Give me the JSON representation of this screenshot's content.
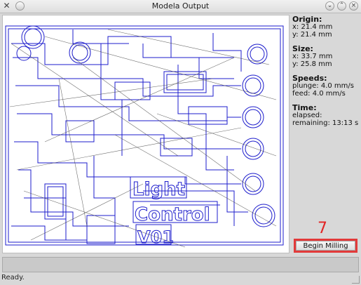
{
  "window": {
    "title": "Modela Output",
    "close_glyph": "✕"
  },
  "info": {
    "origin": {
      "heading": "Origin:",
      "x": "x: 21.4 mm",
      "y": "y: 21.4 mm"
    },
    "size": {
      "heading": "Size:",
      "x": "x: 33.7 mm",
      "y": "y: 25.8 mm"
    },
    "speeds": {
      "heading": "Speeds:",
      "plunge": "plunge: 4.0 mm/s",
      "feed": "feed: 4.0 mm/s"
    },
    "time": {
      "heading": "Time:",
      "elapsed": "elapsed:",
      "remaining": "remaining: 13:13 s"
    }
  },
  "annotation": {
    "step": "7",
    "color": "#e22525"
  },
  "actions": {
    "begin_label": "Begin Milling"
  },
  "status": {
    "text": "Ready."
  },
  "colors": {
    "toolpath": "#1d1dcc",
    "travel": "#4a4a4a",
    "background": "#ffffff"
  },
  "canvas": {
    "board_text_lines": [
      "Light",
      "Control",
      "V01"
    ]
  }
}
